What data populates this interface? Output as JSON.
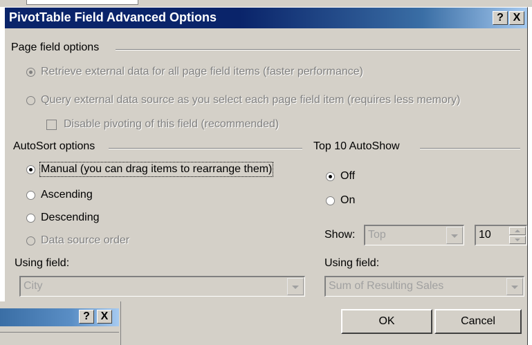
{
  "dialog": {
    "title": "PivotTable Field Advanced Options",
    "help_label": "?",
    "close_label": "X"
  },
  "page_field": {
    "section_label": "Page field options",
    "retrieve_label": "Retrieve external data for all page field items (faster performance)",
    "query_label": "Query external data source as you select each page field item (requires less memory)",
    "disable_label": "Disable pivoting of this field (recommended)"
  },
  "autosort": {
    "section_label": "AutoSort options",
    "options": [
      "Manual (you can drag items to rearrange them)",
      "Ascending",
      "Descending",
      "Data source order"
    ],
    "selected": "Manual (you can drag items to rearrange them)",
    "using_field_label": "Using field:",
    "using_field_value": "City"
  },
  "top10": {
    "section_label": "Top 10 AutoShow",
    "off_label": "Off",
    "on_label": "On",
    "selected": "Off",
    "show_label": "Show:",
    "show_value": "Top",
    "count_value": "10",
    "using_field_label": "Using field:",
    "using_field_value": "Sum of Resulting Sales"
  },
  "buttons": {
    "ok_label": "OK",
    "cancel_label": "Cancel"
  },
  "background_window": {
    "help_label": "?",
    "close_label": "X"
  }
}
